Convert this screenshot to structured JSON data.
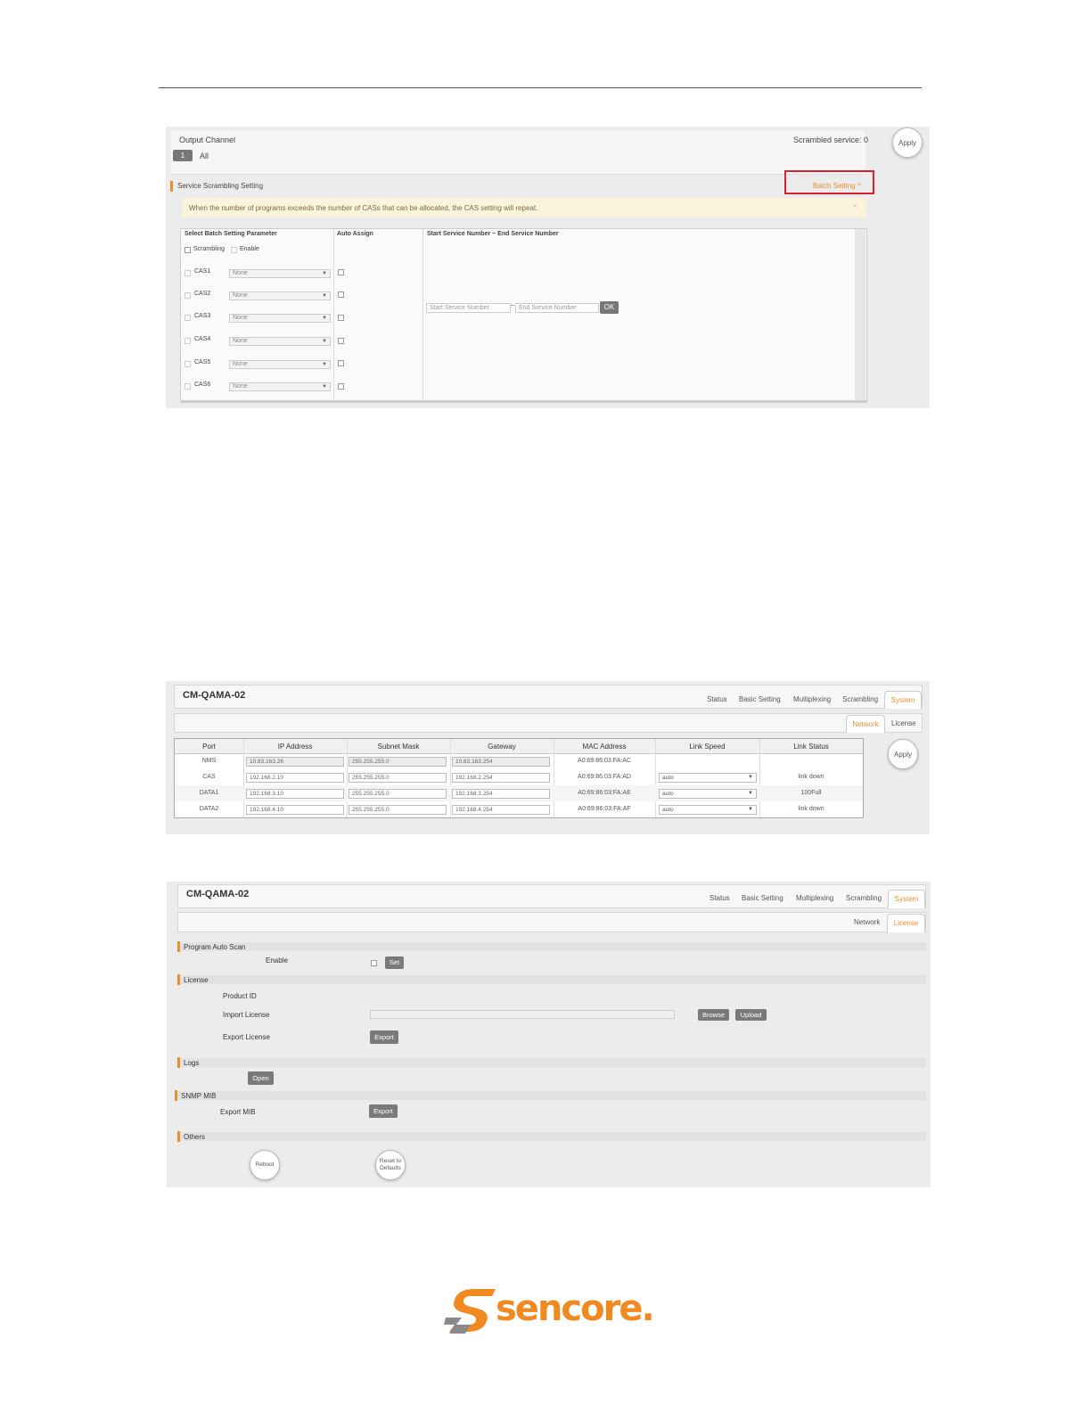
{
  "panel1": {
    "header": {
      "title": "Output Channel",
      "scrambled_service": "Scrambled service: 0"
    },
    "apply_label": "Apply",
    "channel": {
      "number": "1",
      "all_label": "All"
    },
    "section_title": "Service Scrambling Setting",
    "batch_setting": "Batch Setting",
    "notice": "When the number of programs exceeds the number of CASs that can be allocated, the CAS setting will repeat.",
    "notice_close": "×",
    "table": {
      "col1": "Select Batch Setting Parameter",
      "col2": "Auto Assign",
      "col3": "Start Service Number ~ End Service Number",
      "scrambling_label": "Scrambling",
      "enable_label": "Enable",
      "cas_rows": [
        {
          "label": "CAS1",
          "value": "None"
        },
        {
          "label": "CAS2",
          "value": "None"
        },
        {
          "label": "CAS3",
          "value": "None"
        },
        {
          "label": "CAS4",
          "value": "None"
        },
        {
          "label": "CAS5",
          "value": "None"
        },
        {
          "label": "CAS6",
          "value": "None"
        }
      ],
      "start_placeholder": "Start Service Number",
      "tilde": "~",
      "end_placeholder": "End Service Number",
      "ok_label": "OK"
    }
  },
  "panel2": {
    "device": "CM-QAMA-02",
    "tabs": [
      "Status",
      "Basic Setting",
      "Multiplexing",
      "Scrambling",
      "System"
    ],
    "subtabs": [
      "Network",
      "License"
    ],
    "apply_label": "Apply",
    "columns": [
      "Port",
      "IP Address",
      "Subnet Mask",
      "Gateway",
      "MAC Address",
      "Link Speed",
      "Link Status"
    ],
    "rows": [
      {
        "port": "NMS",
        "ip": "10.83.163.26",
        "mask": "255.255.255.0",
        "gw": "10.83.163.254",
        "mac": "A0:69:86:03:FA:AC",
        "speed": "",
        "status": ""
      },
      {
        "port": "CAS",
        "ip": "192.168.2.10",
        "mask": "255.255.255.0",
        "gw": "192.168.2.254",
        "mac": "A0:69:86:03:FA:AD",
        "speed": "auto",
        "status": "link down"
      },
      {
        "port": "DATA1",
        "ip": "192.168.3.10",
        "mask": "255.255.255.0",
        "gw": "192.168.3.254",
        "mac": "A0:69:86:03:FA:AE",
        "speed": "auto",
        "status": "100Full"
      },
      {
        "port": "DATA2",
        "ip": "192.168.4.10",
        "mask": "255.255.255.0",
        "gw": "192.168.4.254",
        "mac": "A0:69:86:03:FA:AF",
        "speed": "auto",
        "status": "link down"
      }
    ]
  },
  "panel3": {
    "device": "CM-QAMA-02",
    "tabs": [
      "Status",
      "Basic Setting",
      "Multiplexing",
      "Scrambling",
      "System"
    ],
    "subtabs": [
      "Network",
      "License"
    ],
    "program_auto_scan": {
      "title": "Program Auto Scan",
      "enable_label": "Enable",
      "set_label": "Set"
    },
    "license": {
      "title": "License",
      "product_id": "Product ID",
      "import_label": "Import License",
      "browse": "Browse",
      "upload": "Upload",
      "export_label": "Export License",
      "export_btn": "Export"
    },
    "logs": {
      "title": "Logs",
      "open": "Open"
    },
    "snmp": {
      "title": "SNMP MIB",
      "export_label": "Export MIB",
      "export_btn": "Export"
    },
    "others": {
      "title": "Others",
      "reboot": "Reboot",
      "reset": "Reset to Defaults"
    }
  },
  "footer": {
    "brand": "sencore.",
    "brand_color": "#f0891f",
    "mark_color": "#8a8a8a"
  }
}
